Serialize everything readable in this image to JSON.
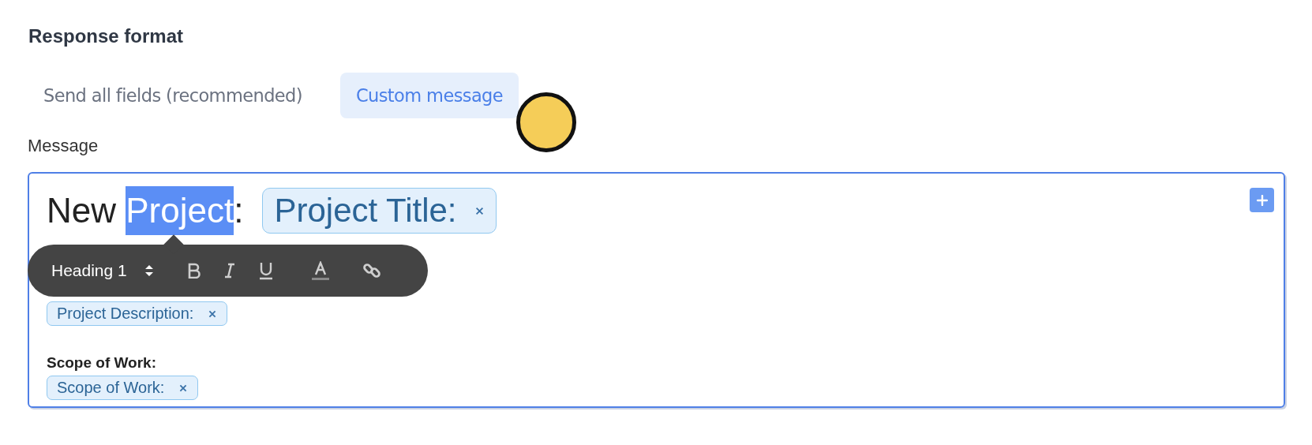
{
  "section_title": "Response format",
  "tabs": [
    {
      "label": "Send all fields (recommended)",
      "selected": false
    },
    {
      "label": "Custom message",
      "selected": true
    }
  ],
  "message": {
    "label": "Message",
    "heading": {
      "parts": [
        {
          "text": "New ",
          "selected": false
        },
        {
          "text": "Project",
          "selected": true
        },
        {
          "text": ":",
          "selected": false
        }
      ],
      "chip": "Project Title:"
    },
    "blocks": [
      {
        "chip": "Project Description:"
      },
      {
        "title": "Scope of Work:",
        "chip": "Scope of Work:"
      }
    ]
  },
  "format_toolbar": {
    "block_style": "Heading 1"
  }
}
